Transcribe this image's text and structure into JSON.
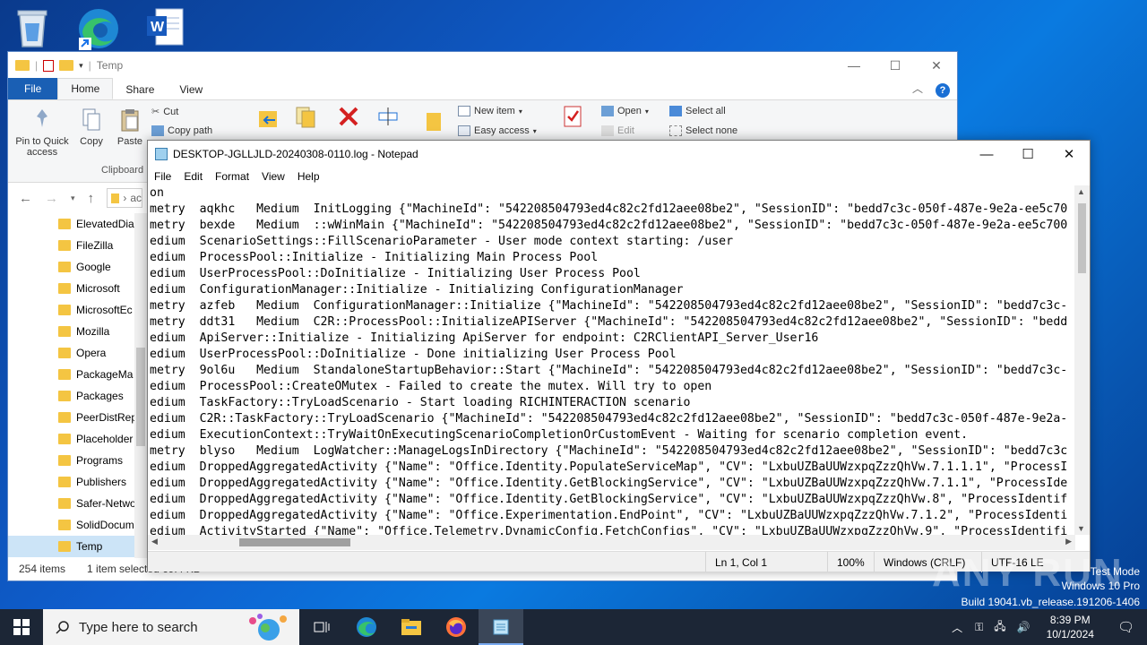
{
  "desktop": {
    "icons": [
      "recycle-bin",
      "microsoft-edge",
      "microsoft-word"
    ]
  },
  "explorer": {
    "title": "Temp",
    "tabs": [
      "File",
      "Home",
      "Share",
      "View"
    ],
    "ribbon": {
      "pin_quick_access": "Pin to Quick access",
      "copy": "Copy",
      "paste": "Paste",
      "cut": "Cut",
      "copy_path": "Copy path",
      "clipboard_group": "Clipboard",
      "new_item": "New item",
      "easy_access": "Easy access",
      "open": "Open",
      "edit": "Edit",
      "select_all": "Select all",
      "select_none": "Select none"
    },
    "address": "ac",
    "nav_items": [
      "ElevatedDia",
      "FileZilla",
      "Google",
      "Microsoft",
      "MicrosoftEc",
      "Mozilla",
      "Opera",
      "PackageMa",
      "Packages",
      "PeerDistRep",
      "Placeholder",
      "Programs",
      "Publishers",
      "Safer-Netwo",
      "SolidDocum",
      "Temp"
    ],
    "status_items": "254 items",
    "status_selected": "1 item selected  69.4 KB"
  },
  "notepad": {
    "title": "DESKTOP-JGLLJLD-20240308-0110.log - Notepad",
    "menu": [
      "File",
      "Edit",
      "Format",
      "View",
      "Help"
    ],
    "lines": [
      "on",
      "metry  aqkhc   Medium  InitLogging {\"MachineId\": \"542208504793ed4c82c2fd12aee08be2\", \"SessionID\": \"bedd7c3c-050f-487e-9e2a-ee5c70",
      "metry  bexde   Medium  ::wWinMain {\"MachineId\": \"542208504793ed4c82c2fd12aee08be2\", \"SessionID\": \"bedd7c3c-050f-487e-9e2a-ee5c700",
      "edium  ScenarioSettings::FillScenarioParameter - User mode context starting: /user",
      "edium  ProcessPool::Initialize - Initializing Main Process Pool",
      "edium  UserProcessPool::DoInitialize - Initializing User Process Pool",
      "edium  ConfigurationManager::Initialize - Initializing ConfigurationManager",
      "metry  azfeb   Medium  ConfigurationManager::Initialize {\"MachineId\": \"542208504793ed4c82c2fd12aee08be2\", \"SessionID\": \"bedd7c3c-",
      "metry  ddt31   Medium  C2R::ProcessPool::InitializeAPIServer {\"MachineId\": \"542208504793ed4c82c2fd12aee08be2\", \"SessionID\": \"bedd",
      "edium  ApiServer::Initialize - Initializing ApiServer for endpoint: C2RClientAPI_Server_User16",
      "edium  UserProcessPool::DoInitialize - Done initializing User Process Pool",
      "metry  9ol6u   Medium  StandaloneStartupBehavior::Start {\"MachineId\": \"542208504793ed4c82c2fd12aee08be2\", \"SessionID\": \"bedd7c3c-",
      "edium  ProcessPool::CreateOMutex - Failed to create the mutex. Will try to open",
      "edium  TaskFactory::TryLoadScenario - Start loading RICHINTERACTION scenario",
      "edium  C2R::TaskFactory::TryLoadScenario {\"MachineId\": \"542208504793ed4c82c2fd12aee08be2\", \"SessionID\": \"bedd7c3c-050f-487e-9e2a-",
      "edium  ExecutionContext::TryWaitOnExecutingScenarioCompletionOrCustomEvent - Waiting for scenario completion event.",
      "metry  blyso   Medium  LogWatcher::ManageLogsInDirectory {\"MachineId\": \"542208504793ed4c82c2fd12aee08be2\", \"SessionID\": \"bedd7c3c",
      "edium  DroppedAggregatedActivity {\"Name\": \"Office.Identity.PopulateServiceMap\", \"CV\": \"LxbuUZBaUUWzxpqZzzQhVw.7.1.1.1\", \"ProcessI",
      "edium  DroppedAggregatedActivity {\"Name\": \"Office.Identity.GetBlockingService\", \"CV\": \"LxbuUZBaUUWzxpqZzzQhVw.7.1.1\", \"ProcessIde",
      "edium  DroppedAggregatedActivity {\"Name\": \"Office.Identity.GetBlockingService\", \"CV\": \"LxbuUZBaUUWzxpqZzzQhVw.8\", \"ProcessIdentif",
      "edium  DroppedAggregatedActivity {\"Name\": \"Office.Experimentation.EndPoint\", \"CV\": \"LxbuUZBaUUWzxpqZzzQhVw.7.1.2\", \"ProcessIdenti",
      "edium  ActivityStarted {\"Name\": \"Office.Telemetry.DynamicConfig.FetchConfigs\", \"CV\": \"LxbuUZBaUUWzxpqZzzQhVw.9\", \"ProcessIdentifi"
    ],
    "status": {
      "position": "Ln 1, Col 1",
      "zoom": "100%",
      "line_ending": "Windows (CRLF)",
      "encoding": "UTF-16 LE"
    }
  },
  "watermark": {
    "test_mode": "Test Mode",
    "os": "Windows 10 Pro",
    "build": "Build 19041.vb_release.191206-1406",
    "brand": "ANY RUN"
  },
  "taskbar": {
    "search_placeholder": "Type here to search",
    "time": "8:39 PM",
    "date": "10/1/2024",
    "colors": {
      "taskbar_bg": "#1c2636",
      "accent": "#0078d7"
    }
  }
}
